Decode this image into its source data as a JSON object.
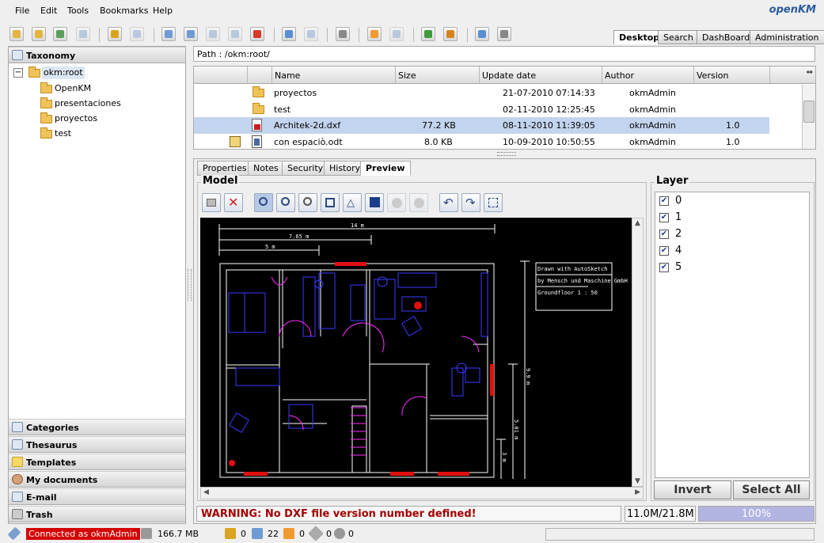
{
  "menu": [
    "File",
    "Edit",
    "Tools",
    "Bookmarks",
    "Help"
  ],
  "brand": {
    "logo": "openKM"
  },
  "toolbar_icons": [
    "create-folder-icon",
    "find-folder-icon",
    "find-document-icon",
    "find-similar-icon",
    "lock-icon",
    "unlock-icon",
    "add-document-icon",
    "edit-icon",
    "checkin-icon",
    "cancel-checkout-icon",
    "delete-icon",
    "add-property-group-icon",
    "remove-property-group-icon",
    "workflow-icon",
    "add-subscription-icon",
    "remove-subscription-icon",
    "refresh-icon",
    "home-icon",
    "scanner-icon",
    "uploader-icon"
  ],
  "main_tabs": [
    {
      "label": "Desktop",
      "selected": true
    },
    {
      "label": "Search",
      "selected": false
    },
    {
      "label": "DashBoard",
      "selected": false
    },
    {
      "label": "Administration",
      "selected": false
    }
  ],
  "taxonomy": {
    "header": "Taxonomy",
    "root": "okm:root",
    "children": [
      "OpenKM",
      "presentaciones",
      "proyectos",
      "test"
    ]
  },
  "stack_sections": [
    "Categories",
    "Thesaurus",
    "Templates",
    "My documents",
    "E-mail",
    "Trash"
  ],
  "path": "Path : /okm:root/",
  "file_table": {
    "columns": [
      "Name",
      "Size",
      "Update date",
      "Author",
      "Version"
    ],
    "rows": [
      {
        "name": "proyectos",
        "size": "",
        "date": "21-07-2010 07:14:33",
        "author": "okmAdmin",
        "version": "",
        "type": "folder",
        "selected": false
      },
      {
        "name": "test",
        "size": "",
        "date": "02-11-2010 12:25:45",
        "author": "okmAdmin",
        "version": "",
        "type": "folder",
        "selected": false
      },
      {
        "name": "Architek-2d.dxf",
        "size": "77.2 KB",
        "date": "08-11-2010 11:39:05",
        "author": "okmAdmin",
        "version": "1.0",
        "type": "dxf",
        "selected": true
      },
      {
        "name": "con espaciò.odt",
        "size": "8.0 KB",
        "date": "10-09-2010 10:50:55",
        "author": "okmAdmin",
        "version": "1.0",
        "type": "odt",
        "selected": false
      }
    ]
  },
  "doc_tabs": [
    {
      "label": "Properties",
      "selected": false
    },
    {
      "label": "Notes",
      "selected": false
    },
    {
      "label": "Security",
      "selected": false
    },
    {
      "label": "History",
      "selected": false
    },
    {
      "label": "Preview",
      "selected": true
    }
  ],
  "model": {
    "legend": "Model",
    "tools": [
      "print-icon",
      "close-icon",
      "zoom-in-icon",
      "zoom-out-icon",
      "zoom-window-icon",
      "zoom-extents-icon",
      "zoom-previous-icon",
      "home-view-icon",
      "disabled-circle-icon",
      "disabled-circle-icon",
      "rotate-left-icon",
      "rotate-right-icon",
      "fit-icon"
    ],
    "drawing_text": {
      "dim1": "14 m",
      "dim2": "7.65 m",
      "dim3": "5 m",
      "title1": "Drawn with AutoSketch",
      "title2": "by Mensch und Maschine GmbH",
      "title3": "Groundfloor 1 : 50",
      "vdim1": "9.9 m",
      "vdim2": "5.01 m",
      "vdim3": "3 m"
    }
  },
  "layer": {
    "legend": "Layer",
    "items": [
      "0",
      "1",
      "2",
      "4",
      "5"
    ],
    "invert_label": "Invert",
    "select_all_label": "Select All"
  },
  "viewer_status": {
    "warning": "WARNING: No DXF file version number defined!",
    "memory": "11.0M/21.8M",
    "progress_text": "100%",
    "progress_value": 1.0
  },
  "statusbar": {
    "connected": "Connected as okmAdmin",
    "disk": "166.7 MB",
    "locked": "0",
    "checkout": "22",
    "subscribed": "0",
    "news": "0",
    "workflow": "0"
  },
  "colors": {
    "accent": "#2a5c9e",
    "selected_row": "#c3d4ee",
    "warning": "#a30000",
    "connected_bg": "#d40000",
    "progress": "#b2b4e2"
  }
}
